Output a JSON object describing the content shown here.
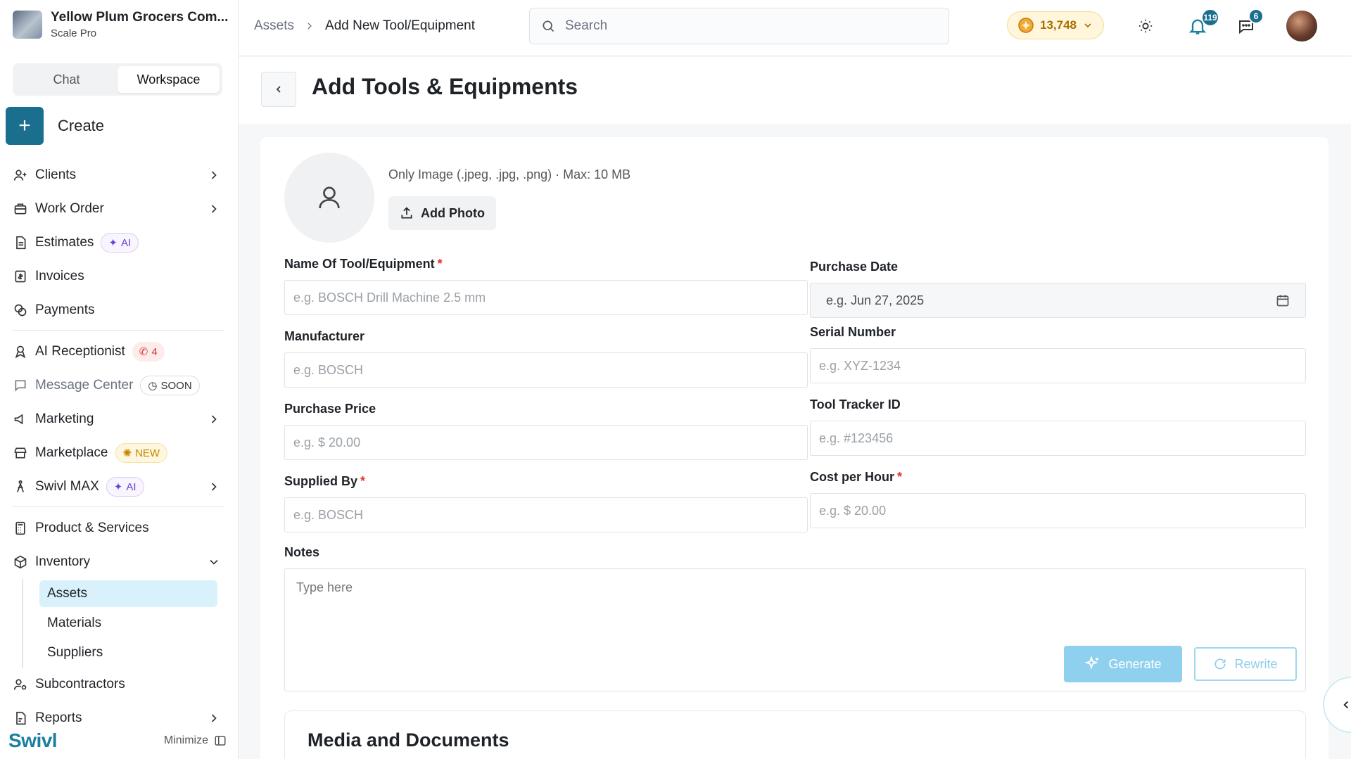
{
  "org": {
    "name": "Yellow Plum Grocers Com...",
    "plan": "Scale Pro"
  },
  "mode_tabs": [
    "Chat",
    "Workspace"
  ],
  "create_label": "Create",
  "nav": {
    "clients": "Clients",
    "work_order": "Work Order",
    "estimates": "Estimates",
    "ai_badge": "AI",
    "invoices": "Invoices",
    "payments": "Payments",
    "ai_receptionist": "AI Receptionist",
    "receptionist_count": "4",
    "message_center": "Message Center",
    "soon_badge": "SOON",
    "marketing": "Marketing",
    "marketplace": "Marketplace",
    "new_badge": "NEW",
    "swivl_max": "Swivl MAX",
    "product_services": "Product & Services",
    "inventory": "Inventory",
    "inventory_sub": [
      "Assets",
      "Materials",
      "Suppliers"
    ],
    "subcontractors": "Subcontractors",
    "reports": "Reports"
  },
  "footer": {
    "logo": "Swivl",
    "minimize": "Minimize"
  },
  "breadcrumb": [
    "Assets",
    "Add New Tool/Equipment"
  ],
  "search": {
    "placeholder": "Search"
  },
  "coins": "13,748",
  "notifications_count": "119",
  "messages_count": "6",
  "page_title": "Add Tools & Equipments",
  "photo": {
    "hint": "Only Image (.jpeg, .jpg, .png) · Max: 10 MB",
    "button": "Add Photo"
  },
  "form": {
    "name": {
      "label": "Name Of Tool/Equipment",
      "placeholder": "e.g. BOSCH Drill Machine 2.5 mm"
    },
    "manufacturer": {
      "label": "Manufacturer",
      "placeholder": "e.g. BOSCH"
    },
    "purchase_price": {
      "label": "Purchase Price",
      "placeholder": "e.g. $ 20.00"
    },
    "supplied_by": {
      "label": "Supplied By",
      "placeholder": "e.g. BOSCH"
    },
    "purchase_date": {
      "label": "Purchase Date",
      "placeholder": "e.g. Jun 27, 2025"
    },
    "serial_number": {
      "label": "Serial Number",
      "placeholder": "e.g. XYZ-1234"
    },
    "tracker_id": {
      "label": "Tool Tracker ID",
      "placeholder": "e.g. #123456"
    },
    "cost_per_hour": {
      "label": "Cost per Hour",
      "placeholder": "e.g. $ 20.00"
    },
    "notes": {
      "label": "Notes",
      "placeholder": "Type here"
    },
    "generate": "Generate",
    "rewrite": "Rewrite",
    "required_mark": "*"
  },
  "media_title": "Media and Documents",
  "colors": {
    "accent": "#1a6f8f",
    "required": "#e0352b",
    "highlight": "#d9f1fb"
  }
}
